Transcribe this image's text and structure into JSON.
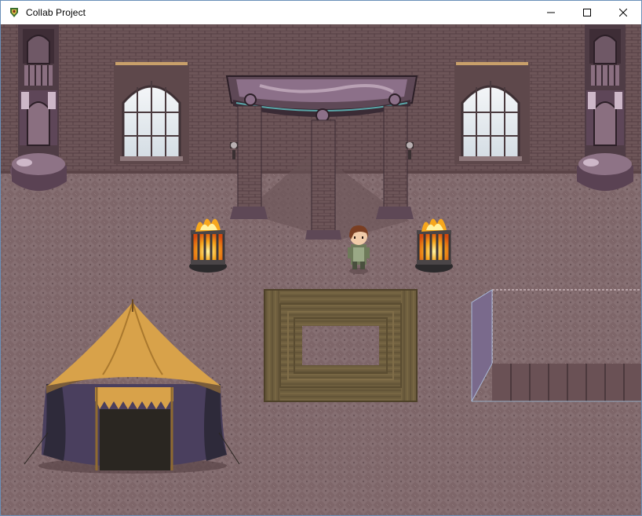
{
  "window": {
    "title": "Collab Project",
    "app_icon": "rpg-maker-icon",
    "controls": {
      "minimize_icon": "minimize-icon",
      "maximize_icon": "maximize-icon",
      "close_icon": "close-icon"
    }
  },
  "scene": {
    "type": "top-down RPG map",
    "colors": {
      "wall_brick": "#6d5558",
      "floor": "#7d6669",
      "wood_mat": "#6b5a3a",
      "tent_canvas": "#d8a24a",
      "tent_drape": "#4a3f5e",
      "fire": "#f7a71d"
    }
  }
}
